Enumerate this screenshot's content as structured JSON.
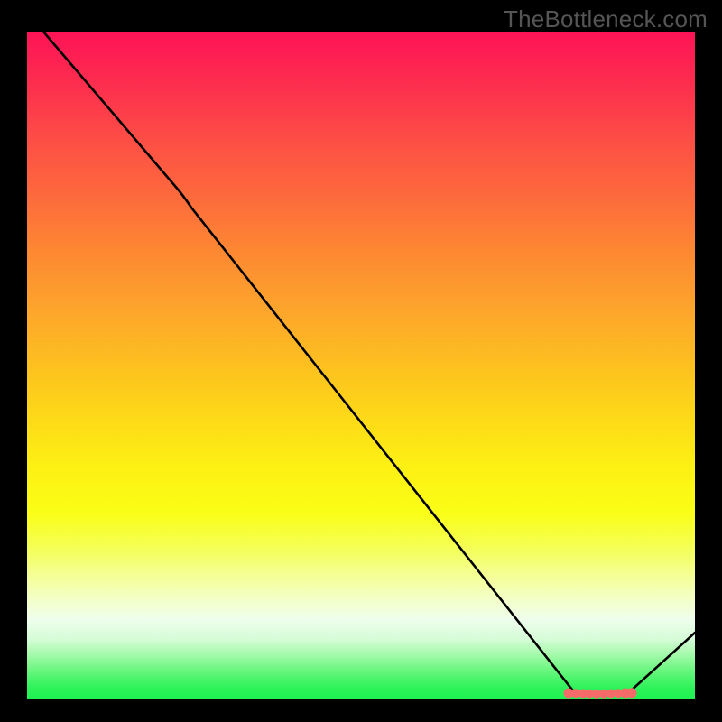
{
  "watermark": "TheBottleneck.com",
  "chart_data": {
    "type": "line",
    "title": "",
    "xlabel": "",
    "ylabel": "",
    "xlim": [
      0,
      100
    ],
    "ylim": [
      0,
      100
    ],
    "x": [
      2.5,
      22,
      82,
      90,
      100
    ],
    "values": [
      100,
      77,
      1,
      1,
      10
    ],
    "markers": {
      "x": [
        82.5,
        83.5,
        84.5,
        85.5,
        86.5,
        87.5,
        88.5,
        89.5,
        90.5
      ],
      "y": [
        1.0,
        0.9,
        0.8,
        0.75,
        0.7,
        0.75,
        0.8,
        0.9,
        1.0
      ],
      "color": "#f76a6a"
    },
    "gradient_stops": [
      {
        "pos": 0.0,
        "color": "#fd1356"
      },
      {
        "pos": 0.5,
        "color": "#fdc01f"
      },
      {
        "pos": 0.72,
        "color": "#fafe16"
      },
      {
        "pos": 0.88,
        "color": "#effeec"
      },
      {
        "pos": 1.0,
        "color": "#1ff152"
      }
    ]
  }
}
